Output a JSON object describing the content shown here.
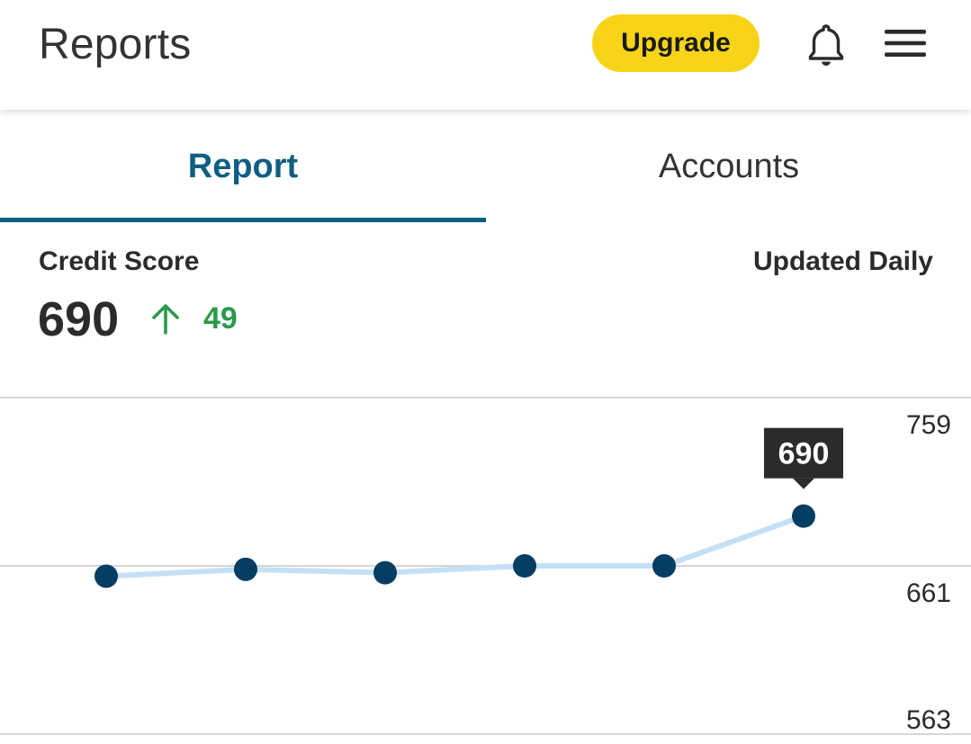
{
  "header": {
    "title": "Reports",
    "upgrade_label": "Upgrade",
    "bell_icon": "bell-icon",
    "menu_icon": "hamburger-menu-icon"
  },
  "tabs": [
    {
      "label": "Report",
      "active": true
    },
    {
      "label": "Accounts",
      "active": false
    }
  ],
  "score": {
    "label": "Credit Score",
    "updated_label": "Updated Daily",
    "value": "690",
    "change": "49",
    "change_icon": "arrow-up-icon"
  },
  "colors": {
    "brand": "#0e5f82",
    "upgrade_yellow": "#f7d417",
    "positive_green": "#2a9a4a",
    "point_navy": "#053d63",
    "line_light_blue": "#c4e0f6",
    "tooltip_bg": "#2b2b2b"
  },
  "chart_data": {
    "type": "line",
    "y_ticks": [
      759,
      661,
      563
    ],
    "ylim": [
      563,
      759
    ],
    "series": [
      {
        "values": [
          655,
          659,
          657,
          661,
          661,
          690
        ]
      }
    ],
    "tooltip": "690",
    "highlight_index": 5
  }
}
